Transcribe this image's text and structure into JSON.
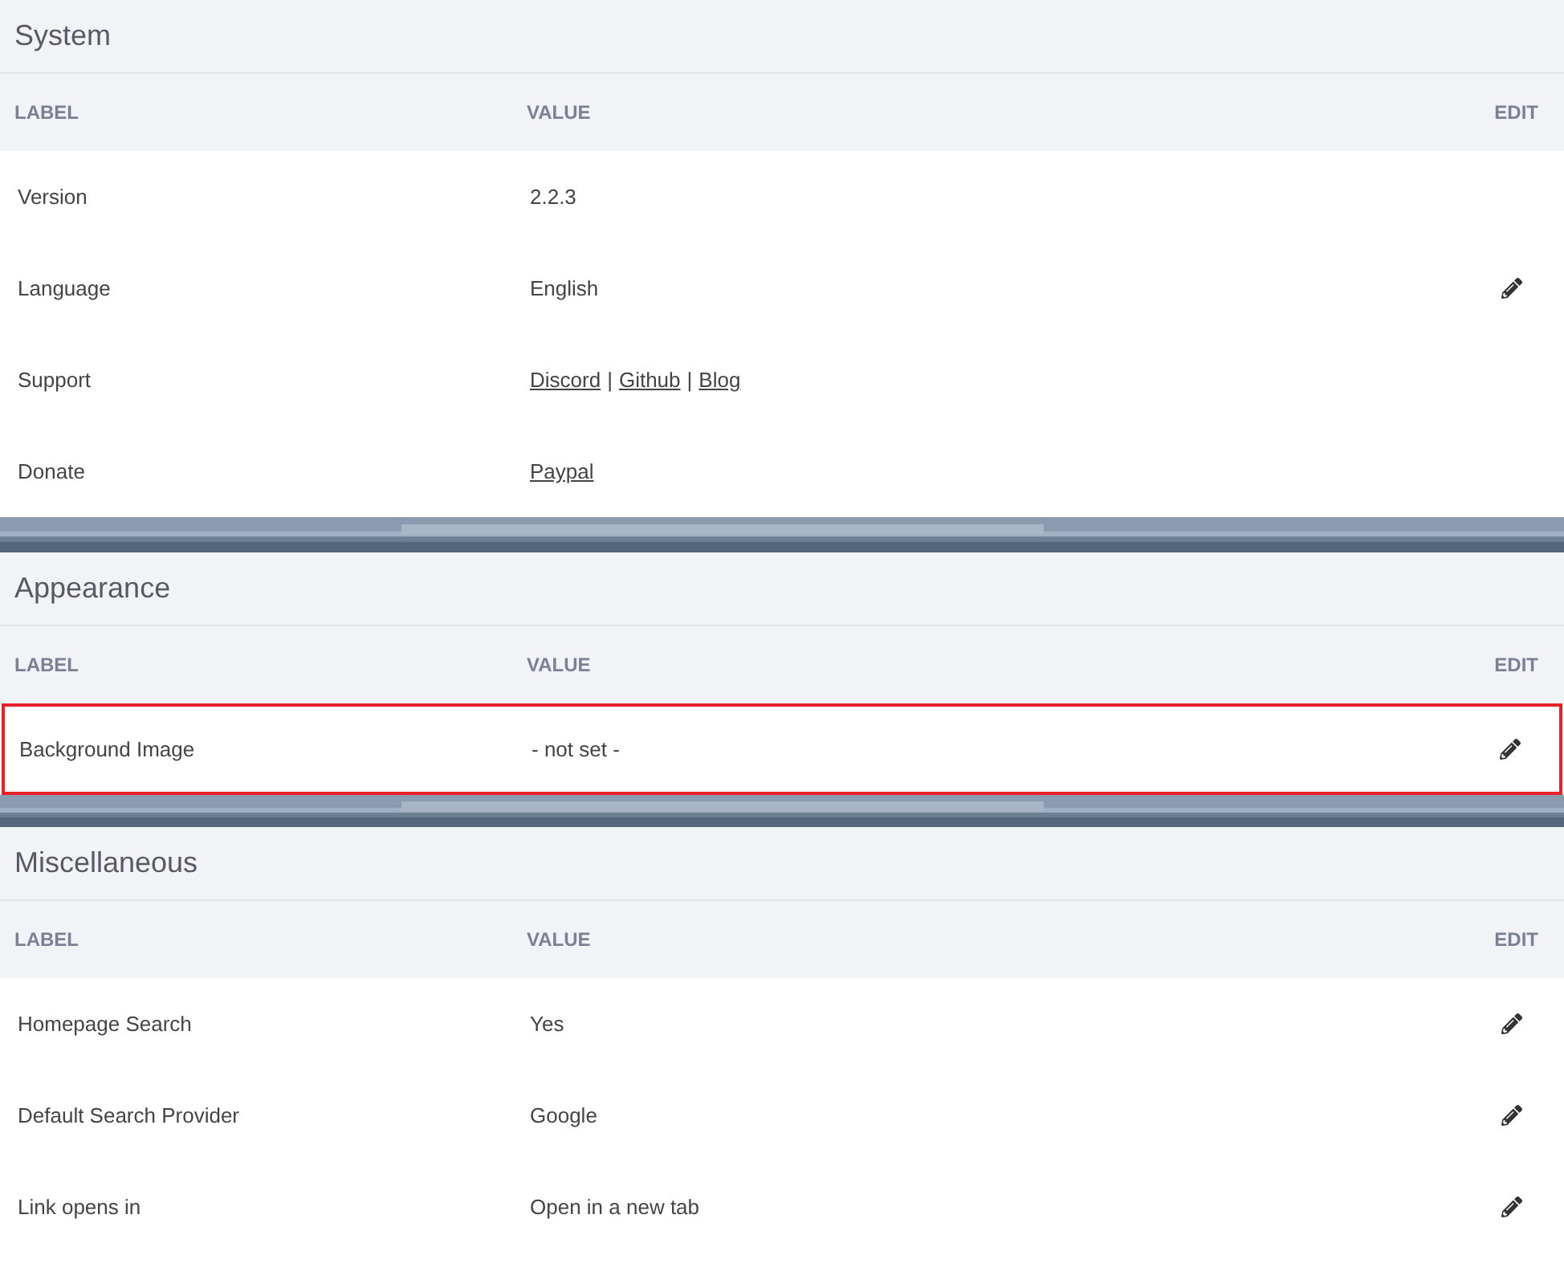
{
  "sections": [
    {
      "title": "System",
      "columns": [
        "LABEL",
        "VALUE",
        "EDIT"
      ],
      "rows": [
        {
          "label": "Version",
          "value": [
            {
              "kind": "text",
              "text": "2.2.3"
            }
          ],
          "editable": false,
          "highlighted": false
        },
        {
          "label": "Language",
          "value": [
            {
              "kind": "text",
              "text": "English"
            }
          ],
          "editable": true,
          "highlighted": false
        },
        {
          "label": "Support",
          "value": [
            {
              "kind": "link",
              "text": "Discord"
            },
            {
              "kind": "text",
              "text": "|"
            },
            {
              "kind": "link",
              "text": "Github"
            },
            {
              "kind": "text",
              "text": "|"
            },
            {
              "kind": "link",
              "text": "Blog"
            }
          ],
          "editable": false,
          "highlighted": false
        },
        {
          "label": "Donate",
          "value": [
            {
              "kind": "link",
              "text": "Paypal"
            }
          ],
          "editable": false,
          "highlighted": false
        }
      ]
    },
    {
      "title": "Appearance",
      "columns": [
        "LABEL",
        "VALUE",
        "EDIT"
      ],
      "rows": [
        {
          "label": "Background Image",
          "value": [
            {
              "kind": "text",
              "text": "- not set -"
            }
          ],
          "editable": true,
          "highlighted": true
        }
      ]
    },
    {
      "title": "Miscellaneous",
      "columns": [
        "LABEL",
        "VALUE",
        "EDIT"
      ],
      "rows": [
        {
          "label": "Homepage Search",
          "value": [
            {
              "kind": "text",
              "text": "Yes"
            }
          ],
          "editable": true,
          "highlighted": false
        },
        {
          "label": "Default Search Provider",
          "value": [
            {
              "kind": "text",
              "text": "Google"
            }
          ],
          "editable": true,
          "highlighted": false
        },
        {
          "label": "Link opens in",
          "value": [
            {
              "kind": "text",
              "text": "Open in a new tab"
            }
          ],
          "editable": true,
          "highlighted": false
        }
      ]
    }
  ]
}
